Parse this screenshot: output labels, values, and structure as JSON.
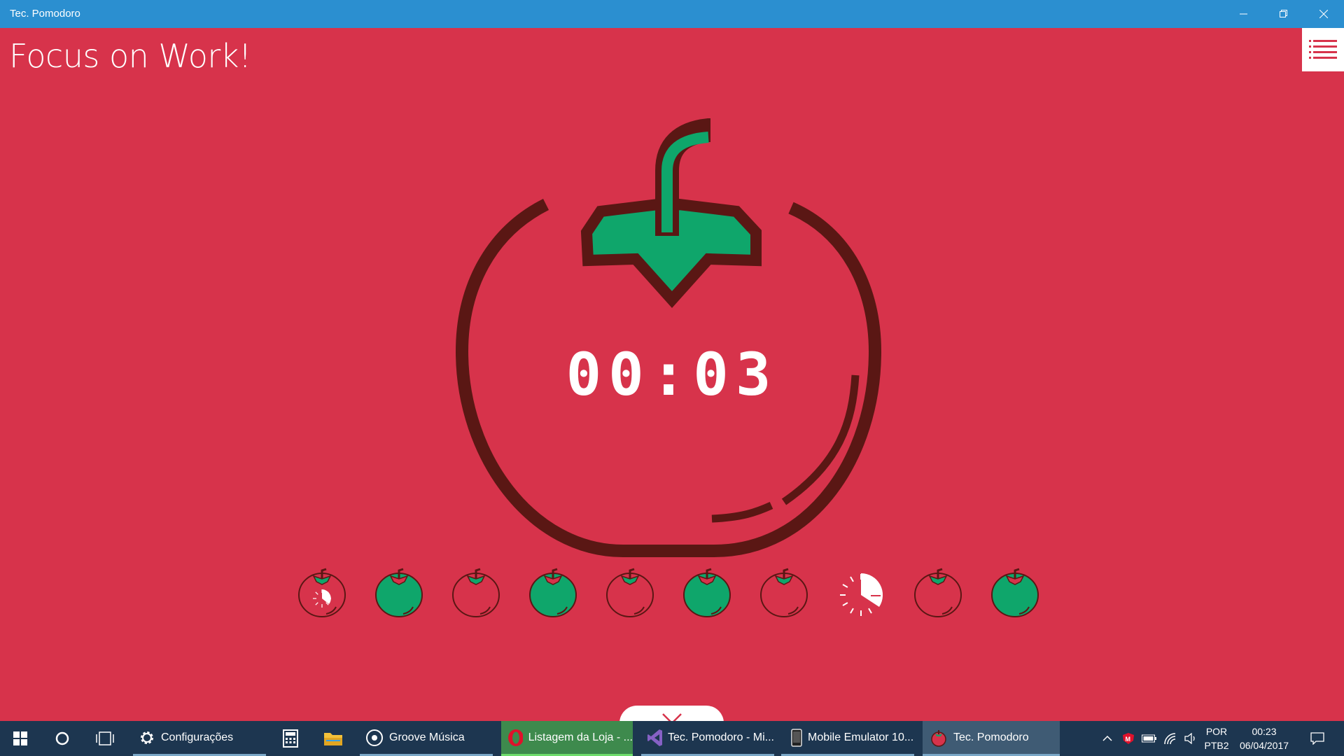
{
  "window": {
    "title": "Tec. Pomodoro",
    "controls": {
      "minimize": "minimize-icon",
      "maximize": "restore-icon",
      "close": "close-icon"
    }
  },
  "main": {
    "heading": "Focus on Work!",
    "menu_icon": "list-icon",
    "timer": "00:03",
    "cancel_icon": "close-icon",
    "pomodoros": [
      {
        "state": "red-partial"
      },
      {
        "state": "green"
      },
      {
        "state": "red"
      },
      {
        "state": "green"
      },
      {
        "state": "red"
      },
      {
        "state": "green"
      },
      {
        "state": "red"
      },
      {
        "state": "timer-active"
      },
      {
        "state": "red"
      },
      {
        "state": "green"
      }
    ]
  },
  "colors": {
    "background": "#d7334b",
    "outline": "#5a1714",
    "leaf": "#0fa66b",
    "titlebar": "#2b8fd0",
    "taskbar": "#1d3650"
  },
  "taskbar": {
    "apps": [
      {
        "label": "Configurações",
        "icon": "gear-icon"
      },
      {
        "label": "",
        "icon": "calculator-icon"
      },
      {
        "label": "",
        "icon": "folder-icon"
      },
      {
        "label": "Groove Música",
        "icon": "music-icon"
      },
      {
        "label": "Listagem da Loja - ...",
        "icon": "opera-icon"
      },
      {
        "label": "Tec. Pomodoro - Mi...",
        "icon": "visual-studio-icon"
      },
      {
        "label": "Mobile Emulator 10...",
        "icon": "phone-icon"
      },
      {
        "label": "Tec. Pomodoro",
        "icon": "tomato-icon"
      }
    ],
    "tray": {
      "language": "POR",
      "layout": "PTB2",
      "time": "00:23",
      "date": "06/04/2017"
    }
  }
}
